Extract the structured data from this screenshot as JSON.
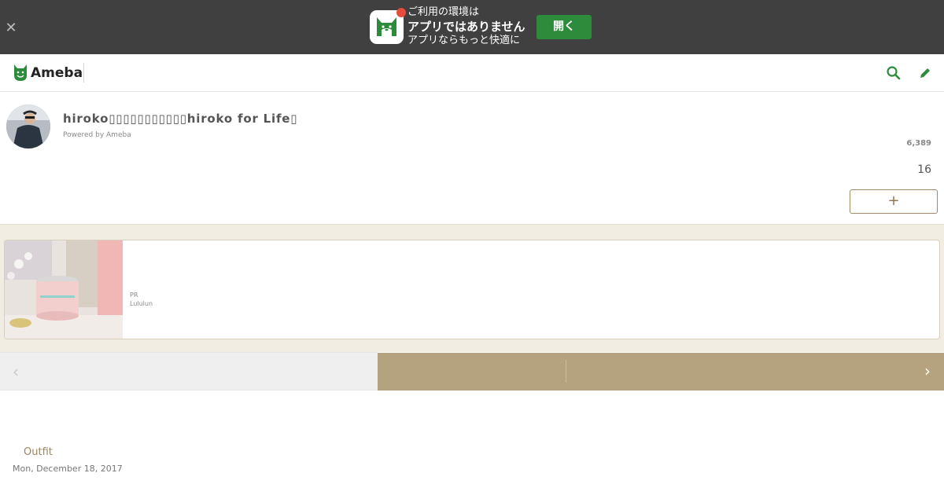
{
  "banner": {
    "close_icon": "close-icon",
    "app_icon": "ameba-app-icon",
    "line1": "ご利用の環境は",
    "line2": "アプリではありません",
    "line3": "アプリならもっと快適に",
    "open_label": "開く",
    "badge_color": "#e84a3c",
    "button_color": "#2d8c3c"
  },
  "header": {
    "logo_text": "Ameba",
    "search_icon": "search-icon",
    "edit_icon": "pencil-icon",
    "brand_color": "#2d8c3c"
  },
  "profile": {
    "title": "hiroko▯▯▯▯▯▯▯▯▯▯▯hiroko for Life▯",
    "powered": "Powered by Ameba",
    "count_a": "6,389",
    "count_b": "16",
    "follow_label": "+"
  },
  "ad": {
    "pr": "PR",
    "brand": "Lululun"
  },
  "pager": {
    "prev": "‹",
    "next": "›",
    "accent_color": "#b5a27e"
  },
  "entry": {
    "theme": "Outfit",
    "date": "Mon, December 18, 2017"
  }
}
